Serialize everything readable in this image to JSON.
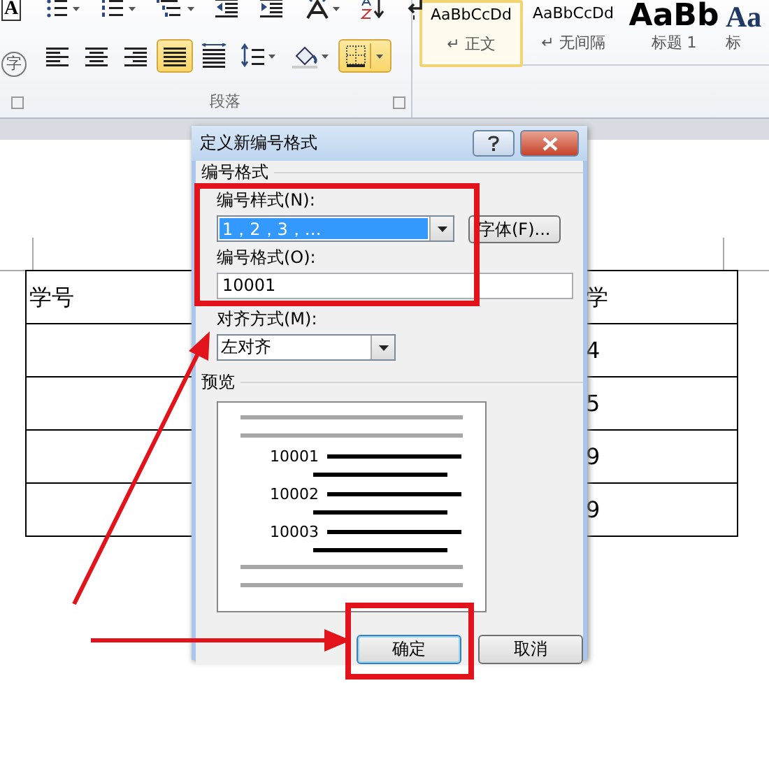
{
  "ribbon": {
    "left_buttons": [
      "A",
      "字"
    ],
    "tool_rows": [
      [
        {
          "kind": "bullets",
          "on": false
        },
        {
          "kind": "numbering",
          "on": false
        },
        {
          "kind": "multilevel",
          "on": false
        },
        {
          "kind": "outdent",
          "on": false
        },
        {
          "kind": "indent",
          "on": false
        },
        {
          "kind": "direction",
          "on": false
        },
        {
          "kind": "sort",
          "on": false
        },
        {
          "kind": "marks",
          "on": false
        }
      ],
      [
        {
          "kind": "left",
          "on": false
        },
        {
          "kind": "center",
          "on": false
        },
        {
          "kind": "right",
          "on": false
        },
        {
          "kind": "justify",
          "on": true
        },
        {
          "kind": "distribute",
          "on": false
        },
        {
          "kind": "spacing",
          "on": false
        },
        {
          "kind": "shading",
          "on": false
        },
        {
          "kind": "borders",
          "on": true
        }
      ]
    ],
    "group_label": "段落",
    "styles": [
      {
        "kind": "normal",
        "sample": "AaBbCcDd",
        "label": "↵ 正文",
        "selected": true
      },
      {
        "kind": "normal",
        "sample": "AaBbCcDd",
        "label": "↵ 无间隔",
        "selected": false
      },
      {
        "kind": "heading1",
        "sample": "AaBb",
        "label": "标题 1",
        "selected": false
      },
      {
        "kind": "heading2",
        "sample": "Aa",
        "label": "标",
        "selected": false
      }
    ]
  },
  "table": {
    "columns": [
      {
        "cells": [
          "学号"
        ]
      },
      {
        "cells": [
          "学",
          "4",
          "5",
          "9",
          "9"
        ]
      }
    ]
  },
  "dialog": {
    "title": "定义新编号格式",
    "group_label": "编号格式",
    "style_label": "编号样式(N):",
    "style_value": "1，2，3，…",
    "font_button": "字体(F)...",
    "format_label": "编号格式(O):",
    "format_value": "10001",
    "align_label": "对齐方式(M):",
    "align_value": "左对齐",
    "preview_label": "预览",
    "preview_numbers": [
      "10001",
      "10002",
      "10003"
    ],
    "buttons": [
      {
        "label": "确定",
        "focused": true
      },
      {
        "label": "取消",
        "focused": false
      }
    ]
  }
}
